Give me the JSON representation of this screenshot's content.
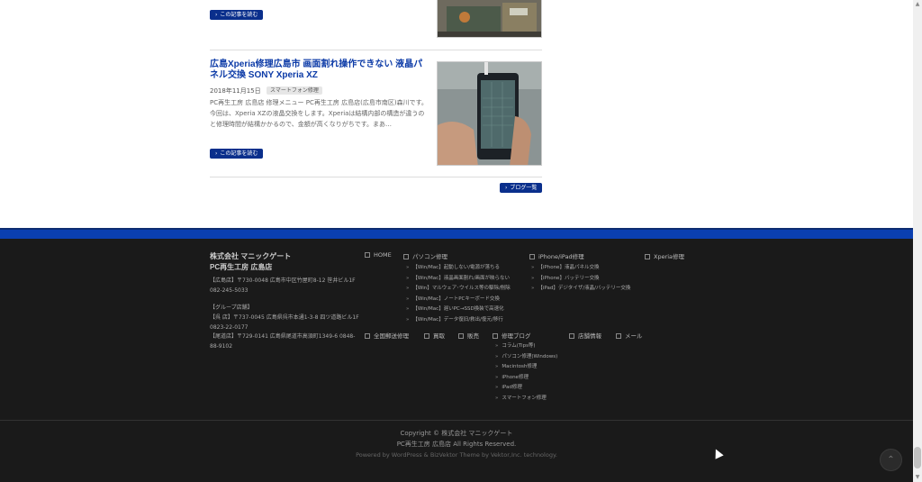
{
  "post_previous": {
    "read_more": "この記事を読む"
  },
  "post": {
    "title": "広島Xperia修理広島市 画面割れ操作できない 液晶パネル交換 SONY Xperia XZ",
    "date": "2018年11月15日",
    "category": "スマートフォン修理",
    "excerpt": "PC再生工房 広島店 修理メニュー PC再生工房 広島店(広島市南区)森川です。今回は、Xperia XZの液晶交換をします。Xperiaは結構内部の構造が違うのと修理時間が結構かかるので、金額が高くなりがちです。まあ…",
    "read_more": "この記事を読む"
  },
  "blog_list_button": "ブログ一覧",
  "footer": {
    "company_line1": "株式会社 マニックゲート",
    "company_line2": "PC再生工房 広島店",
    "address_hiroshima": "【広島店】〒730-0048 広島市中区竹屋町8-12 笹井ビル1F 082-245-5033",
    "group_heading": "【グループ店舗】",
    "address_kure": "【呉 店】〒737-0045 広島県呉市本通1-3-8 四ツ道路ビル1F 0823-22-0177",
    "address_onomichi": "【尾道店】〒729-0141 広島県尾道市高須町1349-6 0848-88-9102",
    "nav": {
      "home": "HOME",
      "pc_repair": "パソコン修理",
      "iphone_ipad_repair": "iPhone/iPad修理",
      "xperia_repair": "Xperia修理",
      "nationwide_repair": "全国郵送修理",
      "buy": "買取",
      "sell": "販売",
      "repair_blog": "修理ブログ",
      "store_info": "店舗情報",
      "mail": "メール"
    },
    "pc_repair_items": [
      "【Win/Mac】起動しない/電源が落ちる",
      "【Win/Mac】液晶画面割れ/画面が映らない",
      "【Win】マルウェア･ウイルス等の駆除/削除",
      "【Win/Mac】ノートPCキーボード交換",
      "【Win/Mac】遅いPC→SSD換装で高速化",
      "【Win/Mac】データ復旧/救出/復元/移行"
    ],
    "iphone_items": [
      "【iPhone】液晶パネル交換",
      "【iPhone】バッテリー交換",
      "【iPad】デジタイザ/液晶/バッテリー交換"
    ],
    "blog_items": [
      "コラム(Tips等)",
      "パソコン修理(Windows)",
      "Macintosh修理",
      "iPhone修理",
      "iPad修理",
      "スマートフォン修理"
    ],
    "copyright_line1": "Copyright © 株式会社 マニックゲート",
    "copyright_line2": "PC再生工房 広島店 All Rights Reserved.",
    "powered": "Powered by WordPress & BizVektor Theme by Vektor,Inc. technology."
  },
  "icons": {
    "to_top": "chevron-up-icon"
  }
}
